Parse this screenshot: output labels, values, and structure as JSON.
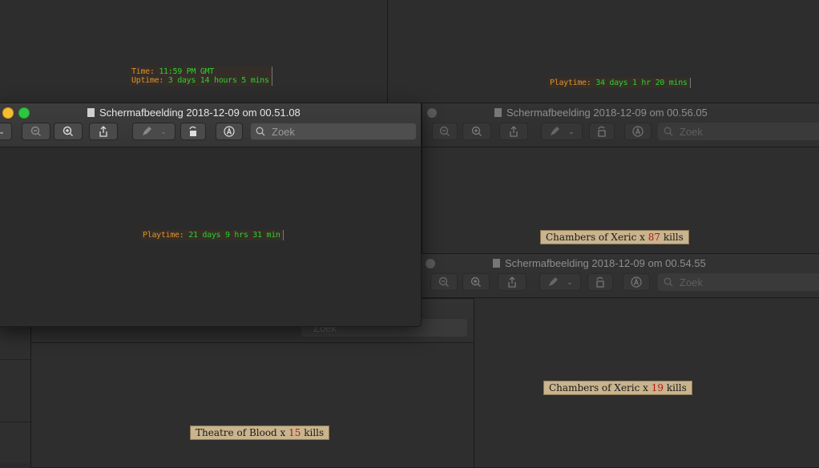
{
  "background_windows": {
    "top_left_game": {
      "time_label": "Time: ",
      "time_value": "11:59 PM GMT",
      "uptime_label": "Uptime: ",
      "uptime_value": "3 days 14 hours 5 mins"
    },
    "top_right_game": {
      "playtime_label": "Playtime: ",
      "playtime_value": "34 days 1 hr 20 mins"
    }
  },
  "windows": {
    "front": {
      "title": "Schermafbeelding 2018-12-09 om 00.51.08",
      "search_placeholder": "Zoek",
      "playtime_label": "Playtime: ",
      "playtime_value": "21 days 9 hrs 31 min"
    },
    "right_top": {
      "title": "Schermafbeelding 2018-12-09 om 00.56.05",
      "search_placeholder": "Zoek",
      "kills_prefix": "Chambers of Xeric x ",
      "kills_count": "87",
      "kills_suffix": " kills"
    },
    "right_bottom": {
      "title": "Schermafbeelding 2018-12-09 om 00.54.55",
      "search_placeholder": "Zoek",
      "kills_prefix": "Chambers of Xeric x ",
      "kills_count": "19",
      "kills_suffix": " kills"
    },
    "bottom_left": {
      "search_placeholder": "Zoek",
      "kills_prefix": "Theatre of Blood x ",
      "kills_count": "15",
      "kills_suffix": " kills"
    }
  },
  "colors": {
    "traffic_yellow": "#f5bd2f",
    "traffic_green": "#2dc73f",
    "game_orange": "#e0902c",
    "game_green": "#2ed02e",
    "kill_count_red": "#b01818"
  }
}
